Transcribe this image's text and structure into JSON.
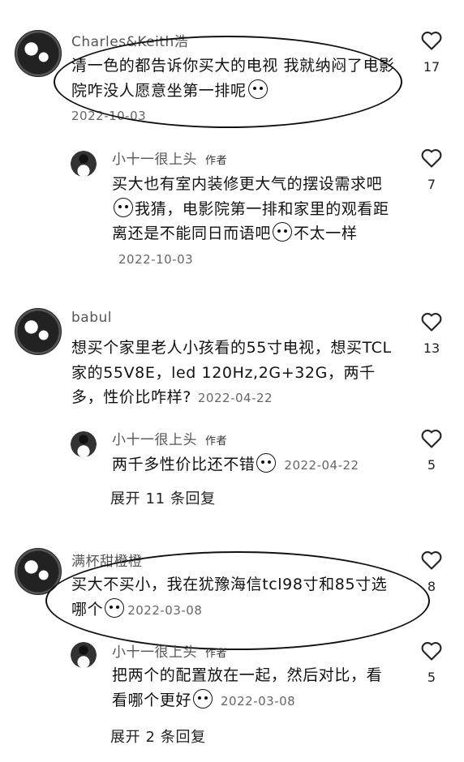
{
  "comments": [
    {
      "author": "Charles&Keith浩",
      "text": "清一色的都告诉你买大的电视 我就纳闷了电影院咋没人愿意坐第一排呢",
      "date": "2022-10-03",
      "likes": "17",
      "replies": [
        {
          "author": "小十一很上头",
          "tag": "作者",
          "text_a": "买大也有室内装修更大气的摆设需求吧",
          "text_b": "我猜，电影院第一排和家里的观看距离还是不能同日而语吧",
          "text_c": "不太一样",
          "date": "2022-10-03",
          "likes": "7"
        }
      ]
    },
    {
      "author": "babul",
      "text": "想买个家里老人小孩看的55寸电视，想买TCL家的55V8E，led 120Hz,2G+32G，两千多，性价比咋样?",
      "date": "2022-04-22",
      "likes": "13",
      "replies": [
        {
          "author": "小十一很上头",
          "tag": "作者",
          "text_a": "两千多性价比还不错",
          "date": "2022-04-22",
          "likes": "5"
        }
      ],
      "expand_label": "展开 11 条回复"
    },
    {
      "author": "满杯甜橙橙",
      "text": "买大不买小，我在犹豫海信tcl98寸和85寸选哪个",
      "date": "2022-03-08",
      "likes": "8",
      "replies": [
        {
          "author": "小十一很上头",
          "tag": "作者",
          "text_a": "把两个的配置放在一起，然后对比，看看哪个更好",
          "date": "2022-03-08",
          "likes": "5"
        }
      ],
      "expand_label": "展开 2 条回复"
    }
  ],
  "icons": {
    "like": "heart-outline-icon",
    "emoji": "smile-emoji-icon"
  }
}
